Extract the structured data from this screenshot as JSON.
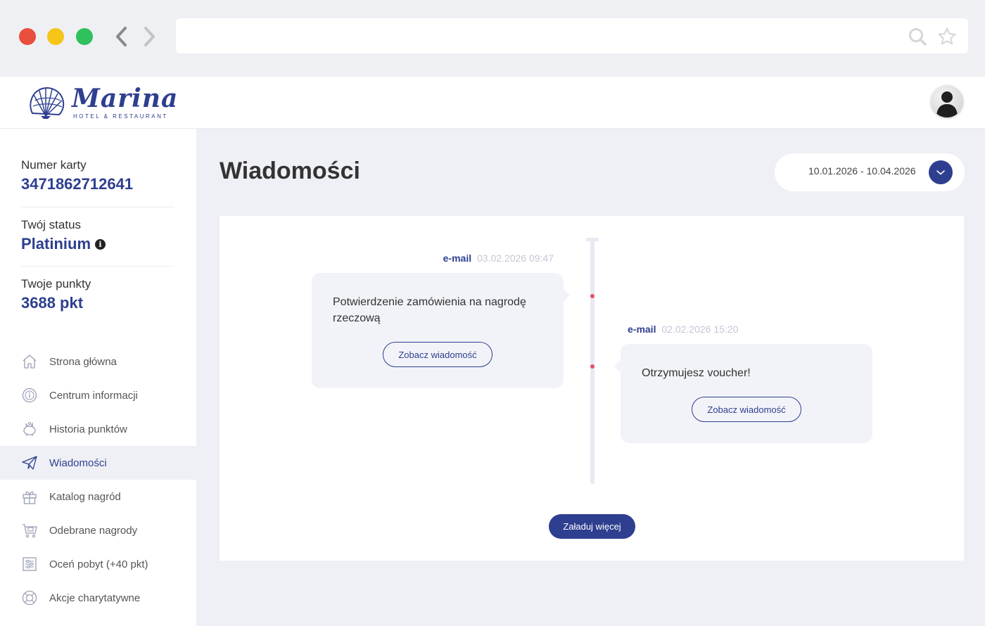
{
  "header": {
    "logo_word": "Marina",
    "logo_subtitle": "HOTEL & RESTAURANT"
  },
  "sidebar": {
    "card_number": {
      "label": "Numer karty",
      "value": "3471862712641"
    },
    "status": {
      "label": "Twój status",
      "value": "Platinium"
    },
    "points": {
      "label": "Twoje punkty",
      "value": "3688 pkt"
    },
    "menu": [
      {
        "label": "Strona główna",
        "icon": "home-icon",
        "active": false
      },
      {
        "label": "Centrum informacji",
        "icon": "info-coin-icon",
        "active": false
      },
      {
        "label": "Historia punktów",
        "icon": "piggy-bank-icon",
        "active": false
      },
      {
        "label": "Wiadomości",
        "icon": "paper-plane-icon",
        "active": true
      },
      {
        "label": "Katalog nagród",
        "icon": "gift-box-icon",
        "active": false
      },
      {
        "label": "Odebrane nagrody",
        "icon": "gift-cart-icon",
        "active": false
      },
      {
        "label": "Oceń pobyt (+40 pkt)",
        "icon": "rating-sliders-icon",
        "active": false
      },
      {
        "label": "Akcje charytatywne",
        "icon": "lifebuoy-icon",
        "active": false
      }
    ]
  },
  "main": {
    "title": "Wiadomości",
    "date_range": "10.01.2026 - 10.04.2026",
    "messages": [
      {
        "type": "e-mail",
        "timestamp": "03.02.2026 09:47",
        "text": "Potwierdzenie zamówienia na nagrodę rzeczową",
        "button": "Zobacz wiadomość"
      },
      {
        "type": "e-mail",
        "timestamp": "02.02.2026 15:20",
        "text": "Otrzymujesz voucher!",
        "button": "Zobacz wiadomość"
      }
    ],
    "load_more": "Załaduj więcej"
  },
  "colors": {
    "brand": "#2e3f8f",
    "timeline_dot": "#e8516a",
    "page_bg": "#eff0f5",
    "bubble_bg": "#f2f3f8"
  }
}
